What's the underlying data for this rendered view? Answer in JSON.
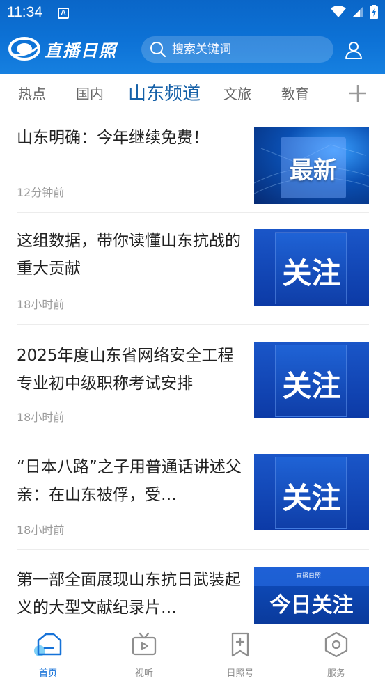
{
  "status_bar": {
    "time": "11:34",
    "notification_icon": "A"
  },
  "header": {
    "logo_text": "直播日照",
    "search_placeholder": "搜索关键词",
    "brand_color": "#0d72d6"
  },
  "tabs": [
    {
      "label": "热点"
    },
    {
      "label": "国内"
    },
    {
      "label": "山东频道"
    },
    {
      "label": "文旅"
    },
    {
      "label": "教育"
    }
  ],
  "active_tab": "山东频道",
  "news": [
    {
      "title": "山东明确：今年继续免费！",
      "time": "12分钟前",
      "badge": "最新"
    },
    {
      "title": "这组数据，带你读懂山东抗战的重大贡献",
      "time": "18小时前",
      "badge": "关注"
    },
    {
      "title": "2025年度山东省网络安全工程专业初中级职称考试安排",
      "time": "18小时前",
      "badge": "关注"
    },
    {
      "title": "“日本八路”之子用普通话讲述父亲：在山东被俘，受…",
      "time": "18小时前",
      "badge": "关注"
    },
    {
      "title": "第一部全面展现山东抗日武装起义的大型文献纪录片…",
      "time": "",
      "badge": "今日关注",
      "badge_logo": "直播日照"
    }
  ],
  "bottom_nav": [
    {
      "label": "首页",
      "icon": "home-icon",
      "active": true
    },
    {
      "label": "视听",
      "icon": "tv-icon"
    },
    {
      "label": "日照号",
      "icon": "bookmark-plus-icon"
    },
    {
      "label": "服务",
      "icon": "hexagon-icon"
    }
  ],
  "accent_color": "#1672d8"
}
